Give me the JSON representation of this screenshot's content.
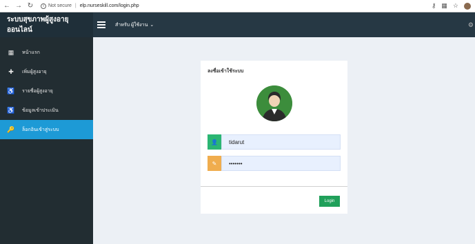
{
  "browser": {
    "not_secure": "Not secure",
    "url": "elp.nurseskill.com/login.php"
  },
  "header": {
    "brand": "ระบบสุขภาพผู้สูงอายุออนไลน์",
    "user_menu": "สำหรับ ผู้ใช้งาน",
    "accent": "#263844"
  },
  "sidebar": {
    "items": [
      {
        "label": "หน้าแรก"
      },
      {
        "label": "เพิ่มผู้สูงอายุ"
      },
      {
        "label": "รายชื่อผู้สูงอายุ"
      },
      {
        "label": "ข้อมูลเข้าประเมิน"
      },
      {
        "label": "ล็อกอินเข้าสู่ระบบ"
      }
    ],
    "active_color": "#1d9ad6"
  },
  "login": {
    "title": "ลงชื่อเข้าใช้ระบบ",
    "username": "tidarut",
    "password": "•••••••",
    "button": "Login",
    "button_color": "#20a05a"
  }
}
